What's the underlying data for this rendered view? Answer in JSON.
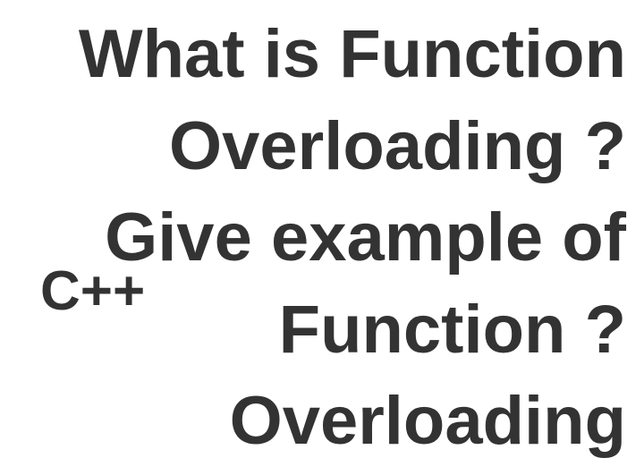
{
  "language_label": "C++",
  "main_text": "What is Function Overloading ? Give example of Function ?Overloading"
}
